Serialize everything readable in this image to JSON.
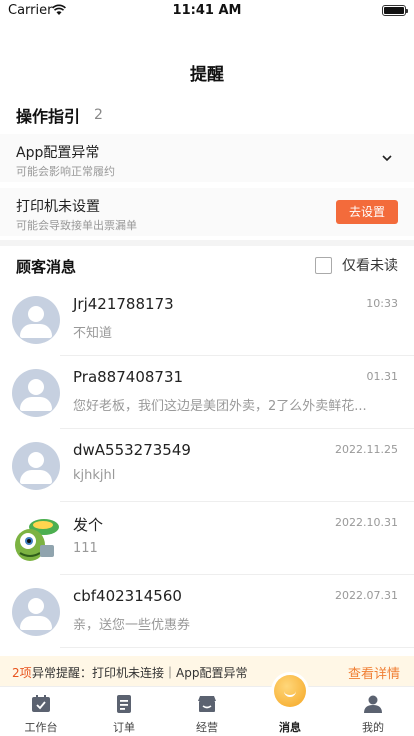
{
  "status_bar": {
    "carrier": "Carrier",
    "time": "11:41 AM"
  },
  "page_title": "提醒",
  "guide": {
    "title": "操作指引",
    "count": "2",
    "items": [
      {
        "title": "App配置异常",
        "subtitle": "可能会影响正常履约"
      },
      {
        "title": "打印机未设置",
        "subtitle": "可能会导致接单出票漏单",
        "action": "去设置"
      }
    ]
  },
  "messages": {
    "title": "顾客消息",
    "filter_label": "仅看未读",
    "items": [
      {
        "name": "Jrj421788173",
        "preview": "不知道",
        "time": "10:33"
      },
      {
        "name": "Pra887408731",
        "preview": "您好老板，我们这边是美团外卖，2了么外卖鲜花...",
        "time": "01.31"
      },
      {
        "name": "dwA553273549",
        "preview": "kjhkjhl",
        "time": "2022.11.25"
      },
      {
        "name": "发个",
        "preview": "111",
        "time": "2022.10.31"
      },
      {
        "name": "cbf402314560",
        "preview": "亲，送您一些优惠券",
        "time": "2022.07.31"
      }
    ]
  },
  "alert": {
    "count": "2项",
    "text": "异常提醒：打印机未连接｜App配置异常",
    "link": "查看详情"
  },
  "tabs": [
    {
      "label": "工作台",
      "icon": "workbench-icon"
    },
    {
      "label": "订单",
      "icon": "order-icon"
    },
    {
      "label": "经营",
      "icon": "business-icon"
    },
    {
      "label": "消息",
      "icon": "message-icon"
    },
    {
      "label": "我的",
      "icon": "profile-icon"
    }
  ],
  "colors": {
    "accent": "#f36b3b",
    "alert_bg": "#fff7e6",
    "link": "#f07f34"
  }
}
